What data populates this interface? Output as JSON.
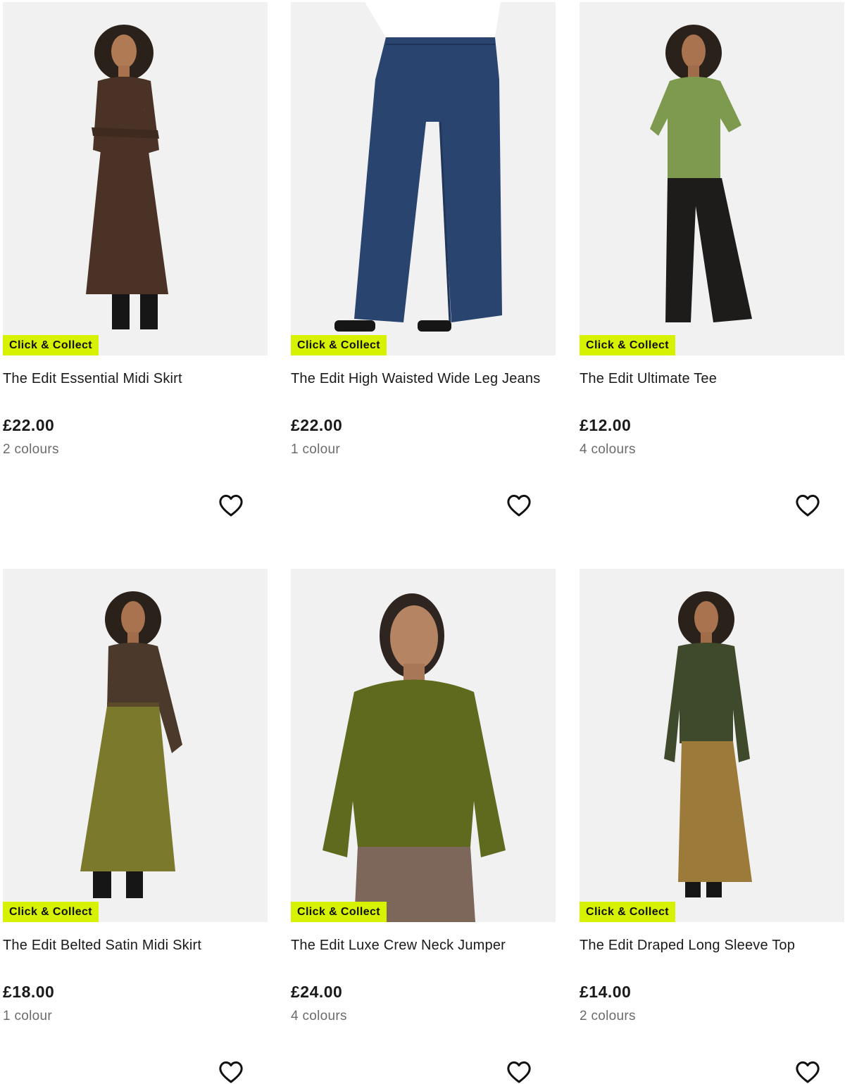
{
  "products": [
    {
      "badge": "Click & Collect",
      "name": "The Edit Essential Midi Skirt",
      "price": "£22.00",
      "colours": "2 colours",
      "image_colors": {
        "top": "#4a3326",
        "bottom": "#4a3326"
      }
    },
    {
      "badge": "Click & Collect",
      "name": "The Edit High Waisted Wide Leg Jeans",
      "price": "£22.00",
      "colours": "1 colour",
      "image_colors": {
        "top": "#ffffff",
        "bottom": "#2a4470"
      }
    },
    {
      "badge": "Click & Collect",
      "name": "The Edit Ultimate Tee",
      "price": "£12.00",
      "colours": "4 colours",
      "image_colors": {
        "top": "#7d9a4f",
        "bottom": "#1e1c1b"
      }
    },
    {
      "badge": "Click & Collect",
      "name": "The Edit Belted Satin Midi Skirt",
      "price": "£18.00",
      "colours": "1 colour",
      "image_colors": {
        "top": "#4b3a2b",
        "bottom": "#7b7a2c"
      }
    },
    {
      "badge": "Click & Collect",
      "name": "The Edit Luxe Crew Neck Jumper",
      "price": "£24.00",
      "colours": "4 colours",
      "image_colors": {
        "top": "#5f6a1e",
        "bottom": "#7d675a"
      }
    },
    {
      "badge": "Click & Collect",
      "name": "The Edit Draped Long Sleeve Top",
      "price": "£14.00",
      "colours": "2 colours",
      "image_colors": {
        "top": "#3f4a2c",
        "bottom": "#9c7a3a"
      }
    }
  ],
  "wishlist_icon": "heart-outline-icon",
  "badge_color": "#d7f200"
}
